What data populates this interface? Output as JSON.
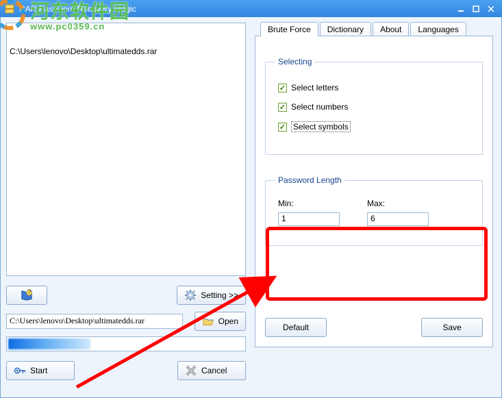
{
  "window": {
    "title": "RAR Password Recovery Magic"
  },
  "watermark": {
    "big": "河东软件园",
    "small": "www.pc0359.cn"
  },
  "list": {
    "line1": "C:\\Users\\lenovo\\Desktop\\ultimatedds.rar"
  },
  "buttons": {
    "help_icon": "help",
    "setting": "Setting >>",
    "open": "Open",
    "start": "Start",
    "cancel": "Cancel",
    "default": "Default",
    "save": "Save"
  },
  "path": {
    "value": "C:\\Users\\lenovo\\Desktop\\ultimatedds.rar"
  },
  "tabs": {
    "brute": "Brute Force",
    "dict": "Dictionary",
    "about": "About",
    "lang": "Languages"
  },
  "selecting": {
    "legend": "Selecting",
    "letters": "Select letters",
    "numbers": "Select numbers",
    "symbols": "Select symbols"
  },
  "passlen": {
    "legend": "Password Length",
    "min_label": "Min:",
    "max_label": "Max:",
    "min": "1",
    "max": "6"
  }
}
